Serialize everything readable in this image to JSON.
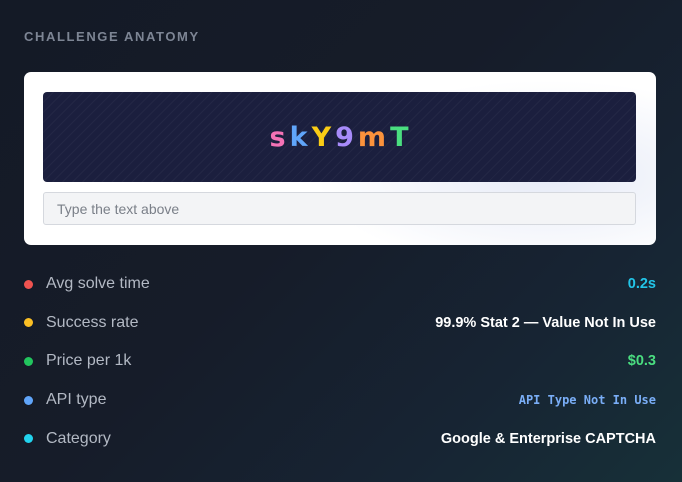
{
  "header": {
    "title": "CHALLENGE ANATOMY"
  },
  "captcha": {
    "characters": [
      {
        "char": "s",
        "color": "#f472b6"
      },
      {
        "char": "k",
        "color": "#60a5fa"
      },
      {
        "char": "Y",
        "color": "#facc15"
      },
      {
        "char": "9",
        "color": "#a78bfa"
      },
      {
        "char": "m",
        "color": "#fb923c"
      },
      {
        "char": "T",
        "color": "#4ade80"
      }
    ],
    "input_placeholder": "Type the text above",
    "input_value": ""
  },
  "stats": [
    {
      "label": "Avg solve time",
      "value": "0.2s",
      "dot_color": "#ef5350",
      "value_color": "#22c5e8",
      "mono": false
    },
    {
      "label": "Success rate",
      "value": "99.9% Stat 2 — Value Not In Use",
      "dot_color": "#fbbf24",
      "value_color": "#ffffff",
      "mono": false
    },
    {
      "label": "Price per 1k",
      "value": "$0.3",
      "dot_color": "#22c55e",
      "value_color": "#4ade80",
      "mono": false
    },
    {
      "label": "API type",
      "value": "API Type Not In Use",
      "dot_color": "#60a5fa",
      "value_color": "#7aaef7",
      "mono": true
    },
    {
      "label": "Category",
      "value": "Google & Enterprise CAPTCHA",
      "dot_color": "#22d3ee",
      "value_color": "#ffffff",
      "mono": false
    }
  ]
}
